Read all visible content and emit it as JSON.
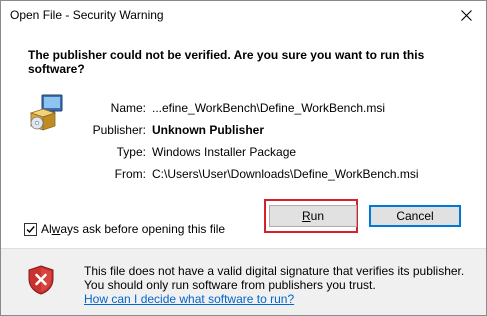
{
  "window": {
    "title": "Open File - Security Warning"
  },
  "warning": {
    "headline": "The publisher could not be verified.  Are you sure you want to run this software?"
  },
  "details": [
    {
      "label": "Name:",
      "value": "...efine_WorkBench\\Define_WorkBench.msi",
      "bold": false
    },
    {
      "label": "Publisher:",
      "value": "Unknown Publisher",
      "bold": true
    },
    {
      "label": "Type:",
      "value": "Windows Installer Package",
      "bold": false
    },
    {
      "label": "From:",
      "value": "C:\\Users\\User\\Downloads\\Define_WorkBench.msi",
      "bold": false
    }
  ],
  "checkbox": {
    "label_before": "Al",
    "label_mnemonic": "w",
    "label_after": "ays ask before opening this file",
    "checked": true
  },
  "buttons": {
    "run_mnemonic": "R",
    "run_rest": "un",
    "cancel": "Cancel"
  },
  "footer": {
    "message": "This file does not have a valid digital signature that verifies its publisher.  You should only run software from publishers you trust.",
    "link": "How can I decide what software to run?"
  },
  "colors": {
    "highlight": "#d9202a",
    "link": "#0066cc",
    "focus_border": "#0078d7",
    "footer_bg": "#f0f0f0",
    "shield_red": "#c9322f"
  },
  "icons": {
    "close": "close-icon",
    "file": "installer-file-icon",
    "shield": "security-shield-icon",
    "check": "checkmark-icon"
  }
}
